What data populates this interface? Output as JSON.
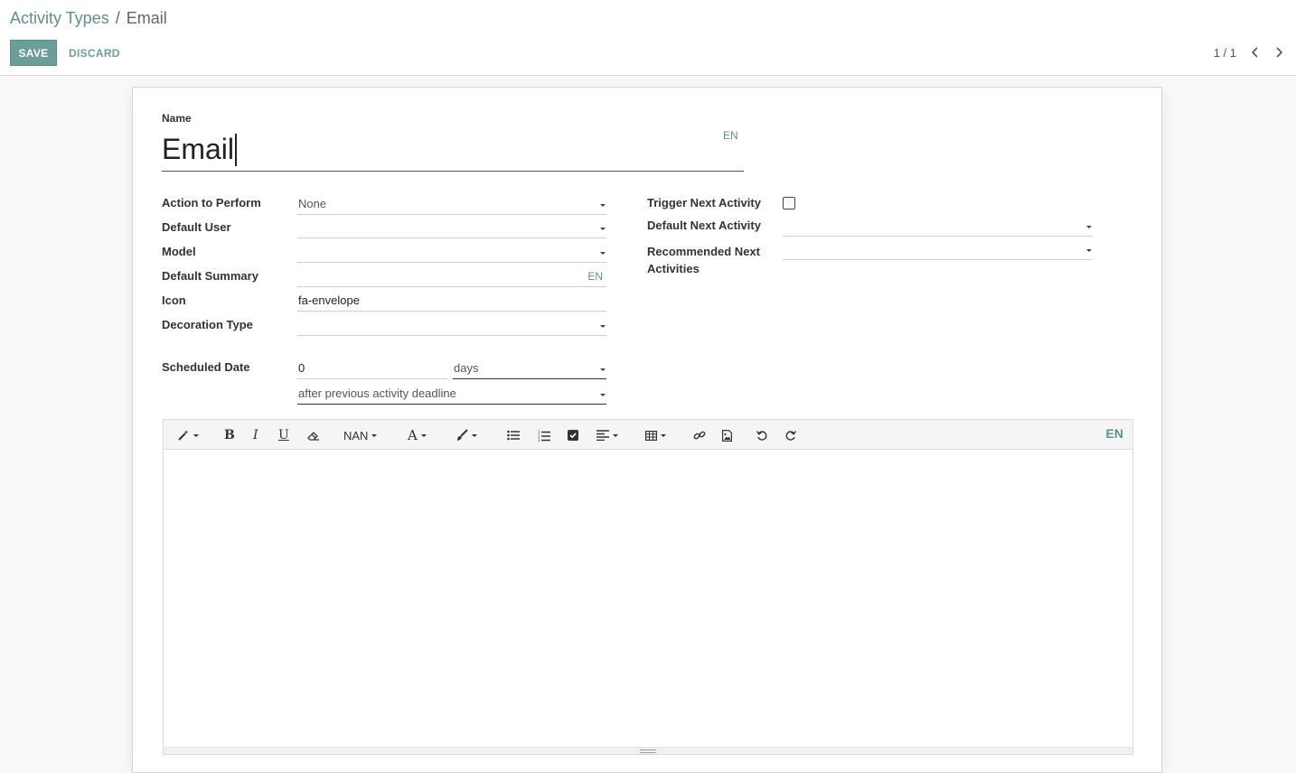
{
  "breadcrumb": {
    "parent": "Activity Types",
    "separator": "/",
    "current": "Email"
  },
  "buttons": {
    "save": "SAVE",
    "discard": "DISCARD"
  },
  "pager": {
    "value": "1 / 1"
  },
  "form": {
    "name_label": "Name",
    "name_value": "Email",
    "lang": "EN",
    "left": {
      "action_label": "Action to Perform",
      "action_value": "None",
      "user_label": "Default User",
      "user_value": "",
      "model_label": "Model",
      "model_value": "",
      "summary_label": "Default Summary",
      "summary_value": "",
      "icon_label": "Icon",
      "icon_value": "fa-envelope",
      "decoration_label": "Decoration Type",
      "decoration_value": "",
      "scheduled_label": "Scheduled Date",
      "scheduled_count": "0",
      "scheduled_unit": "days",
      "scheduled_from": "after previous activity deadline"
    },
    "right": {
      "trigger_label": "Trigger Next Activity",
      "trigger_checked": false,
      "next_label": "Default Next Activity",
      "next_value": "",
      "recommended_label": "Recommended Next Activities",
      "recommended_value": ""
    }
  },
  "editor": {
    "font_label": "NAN",
    "lang": "EN",
    "content": ""
  }
}
